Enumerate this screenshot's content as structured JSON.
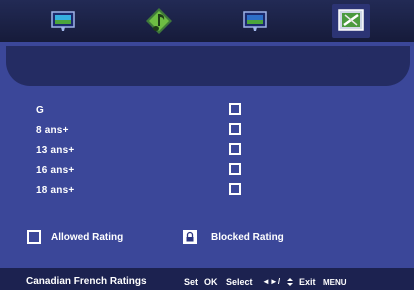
{
  "colors": {
    "background": "#3b4799",
    "tabbar": "#1c2248",
    "header_bar": "#242c63",
    "footer": "#1c2250",
    "text": "#ffffff"
  },
  "tabs": [
    {
      "icon": "tv-picture-icon",
      "active": false
    },
    {
      "icon": "music-note-icon",
      "active": false
    },
    {
      "icon": "tv-screen-icon",
      "active": false
    },
    {
      "icon": "setup-tools-icon",
      "active": true
    }
  ],
  "ratings": [
    {
      "label": "G",
      "blocked": false
    },
    {
      "label": "8 ans+",
      "blocked": false
    },
    {
      "label": "13 ans+",
      "blocked": false
    },
    {
      "label": "16 ans+",
      "blocked": false
    },
    {
      "label": "18 ans+",
      "blocked": false
    }
  ],
  "legend": {
    "allowed_label": "Allowed Rating",
    "blocked_label": "Blocked Rating"
  },
  "footer": {
    "title": "Canadian French Ratings",
    "set_label": "Set",
    "set_key": "OK",
    "select_label": "Select",
    "select_keys": "◄►/",
    "exit_label": "Exit",
    "exit_key": "MENU"
  }
}
